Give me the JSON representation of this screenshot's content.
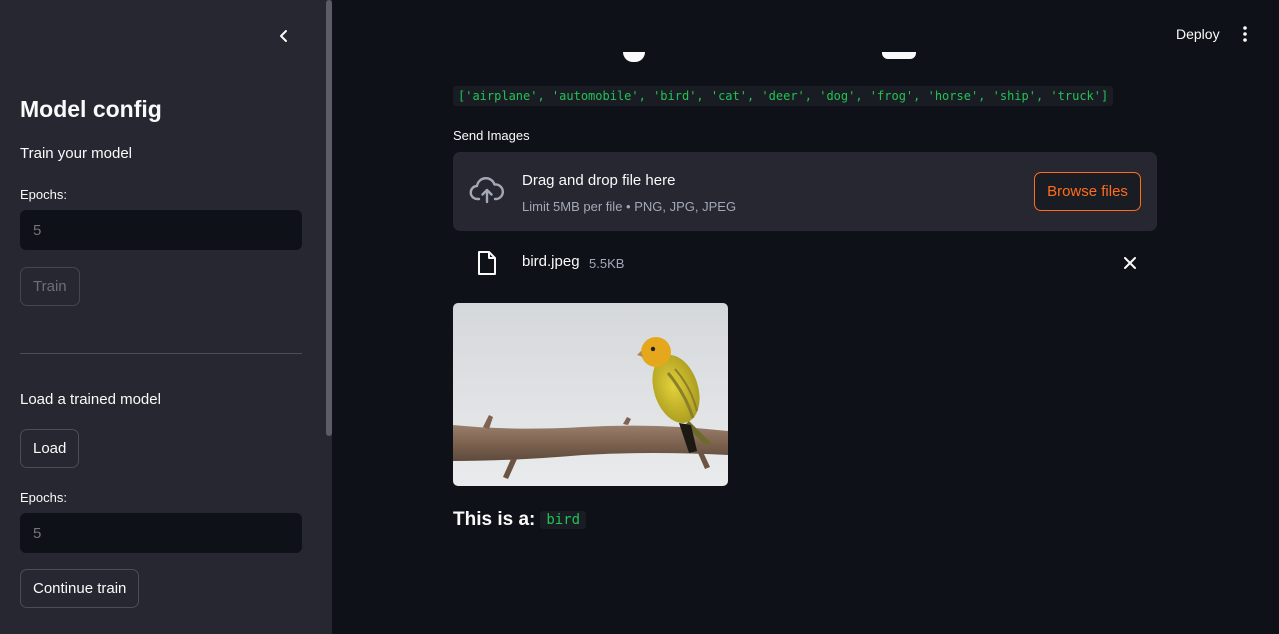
{
  "header": {
    "deploy_label": "Deploy",
    "menu_icon": "kebab-menu-icon"
  },
  "sidebar": {
    "title": "Model config",
    "train_section": {
      "heading": "Train your model",
      "epochs_label": "Epochs:",
      "epochs_placeholder": "5",
      "train_button": "Train"
    },
    "load_section": {
      "heading": "Load a trained model",
      "load_button": "Load",
      "epochs_label": "Epochs:",
      "epochs_placeholder": "5",
      "continue_button": "Continue train"
    }
  },
  "main": {
    "classes_text": "['airplane', 'automobile', 'bird', 'cat', 'deer', 'dog', 'frog', 'horse', 'ship', 'truck']",
    "uploader": {
      "label": "Send Images",
      "title": "Drag and drop file here",
      "subtitle": "Limit 5MB per file • PNG, JPG, JPEG",
      "browse_label": "Browse files"
    },
    "file": {
      "name": "bird.jpeg",
      "size": "5.5KB"
    },
    "result": {
      "prefix": "This is a:",
      "label": "bird"
    }
  },
  "colors": {
    "accent": "#ff6c1a",
    "code_green": "#21c354",
    "background": "#0e1117",
    "sidebar": "#262730"
  }
}
